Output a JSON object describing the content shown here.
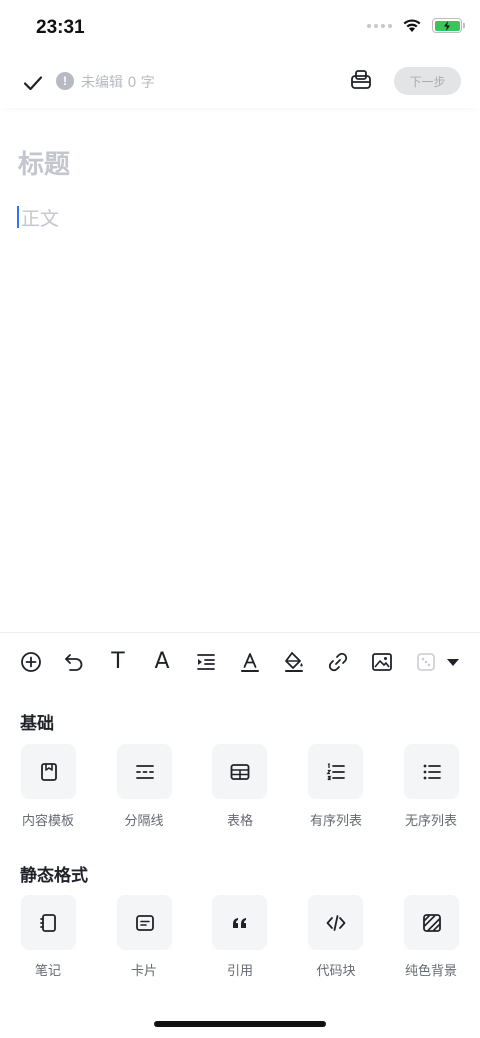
{
  "status_bar": {
    "time": "23:31"
  },
  "topbar": {
    "edit_status": "未编辑 0 字",
    "next_label": "下一步"
  },
  "editor": {
    "title_placeholder": "标题",
    "body_placeholder": "正文"
  },
  "format_toolbar": {
    "items": [
      "add-circle-icon",
      "undo-icon",
      "text-style-icon",
      "font-icon",
      "indent-icon",
      "font-color-icon",
      "highlight-icon",
      "link-icon",
      "image-icon",
      "more-icon"
    ],
    "text_glyph": "T",
    "font_glyph": "A"
  },
  "sections": [
    {
      "title": "基础",
      "items": [
        {
          "label": "内容模板",
          "icon": "template-icon"
        },
        {
          "label": "分隔线",
          "icon": "divider-icon"
        },
        {
          "label": "表格",
          "icon": "table-icon"
        },
        {
          "label": "有序列表",
          "icon": "ordered-list-icon"
        },
        {
          "label": "无序列表",
          "icon": "unordered-list-icon"
        }
      ]
    },
    {
      "title": "静态格式",
      "items": [
        {
          "label": "笔记",
          "icon": "note-icon"
        },
        {
          "label": "卡片",
          "icon": "card-icon"
        },
        {
          "label": "引用",
          "icon": "quote-icon"
        },
        {
          "label": "代码块",
          "icon": "code-block-icon"
        },
        {
          "label": "纯色背景",
          "icon": "solid-background-icon"
        }
      ]
    }
  ],
  "colors": {
    "accent": "#3370ff",
    "placeholder": "#c3c6cc",
    "tile_bg": "#f4f5f6",
    "battery": "#34c759"
  }
}
